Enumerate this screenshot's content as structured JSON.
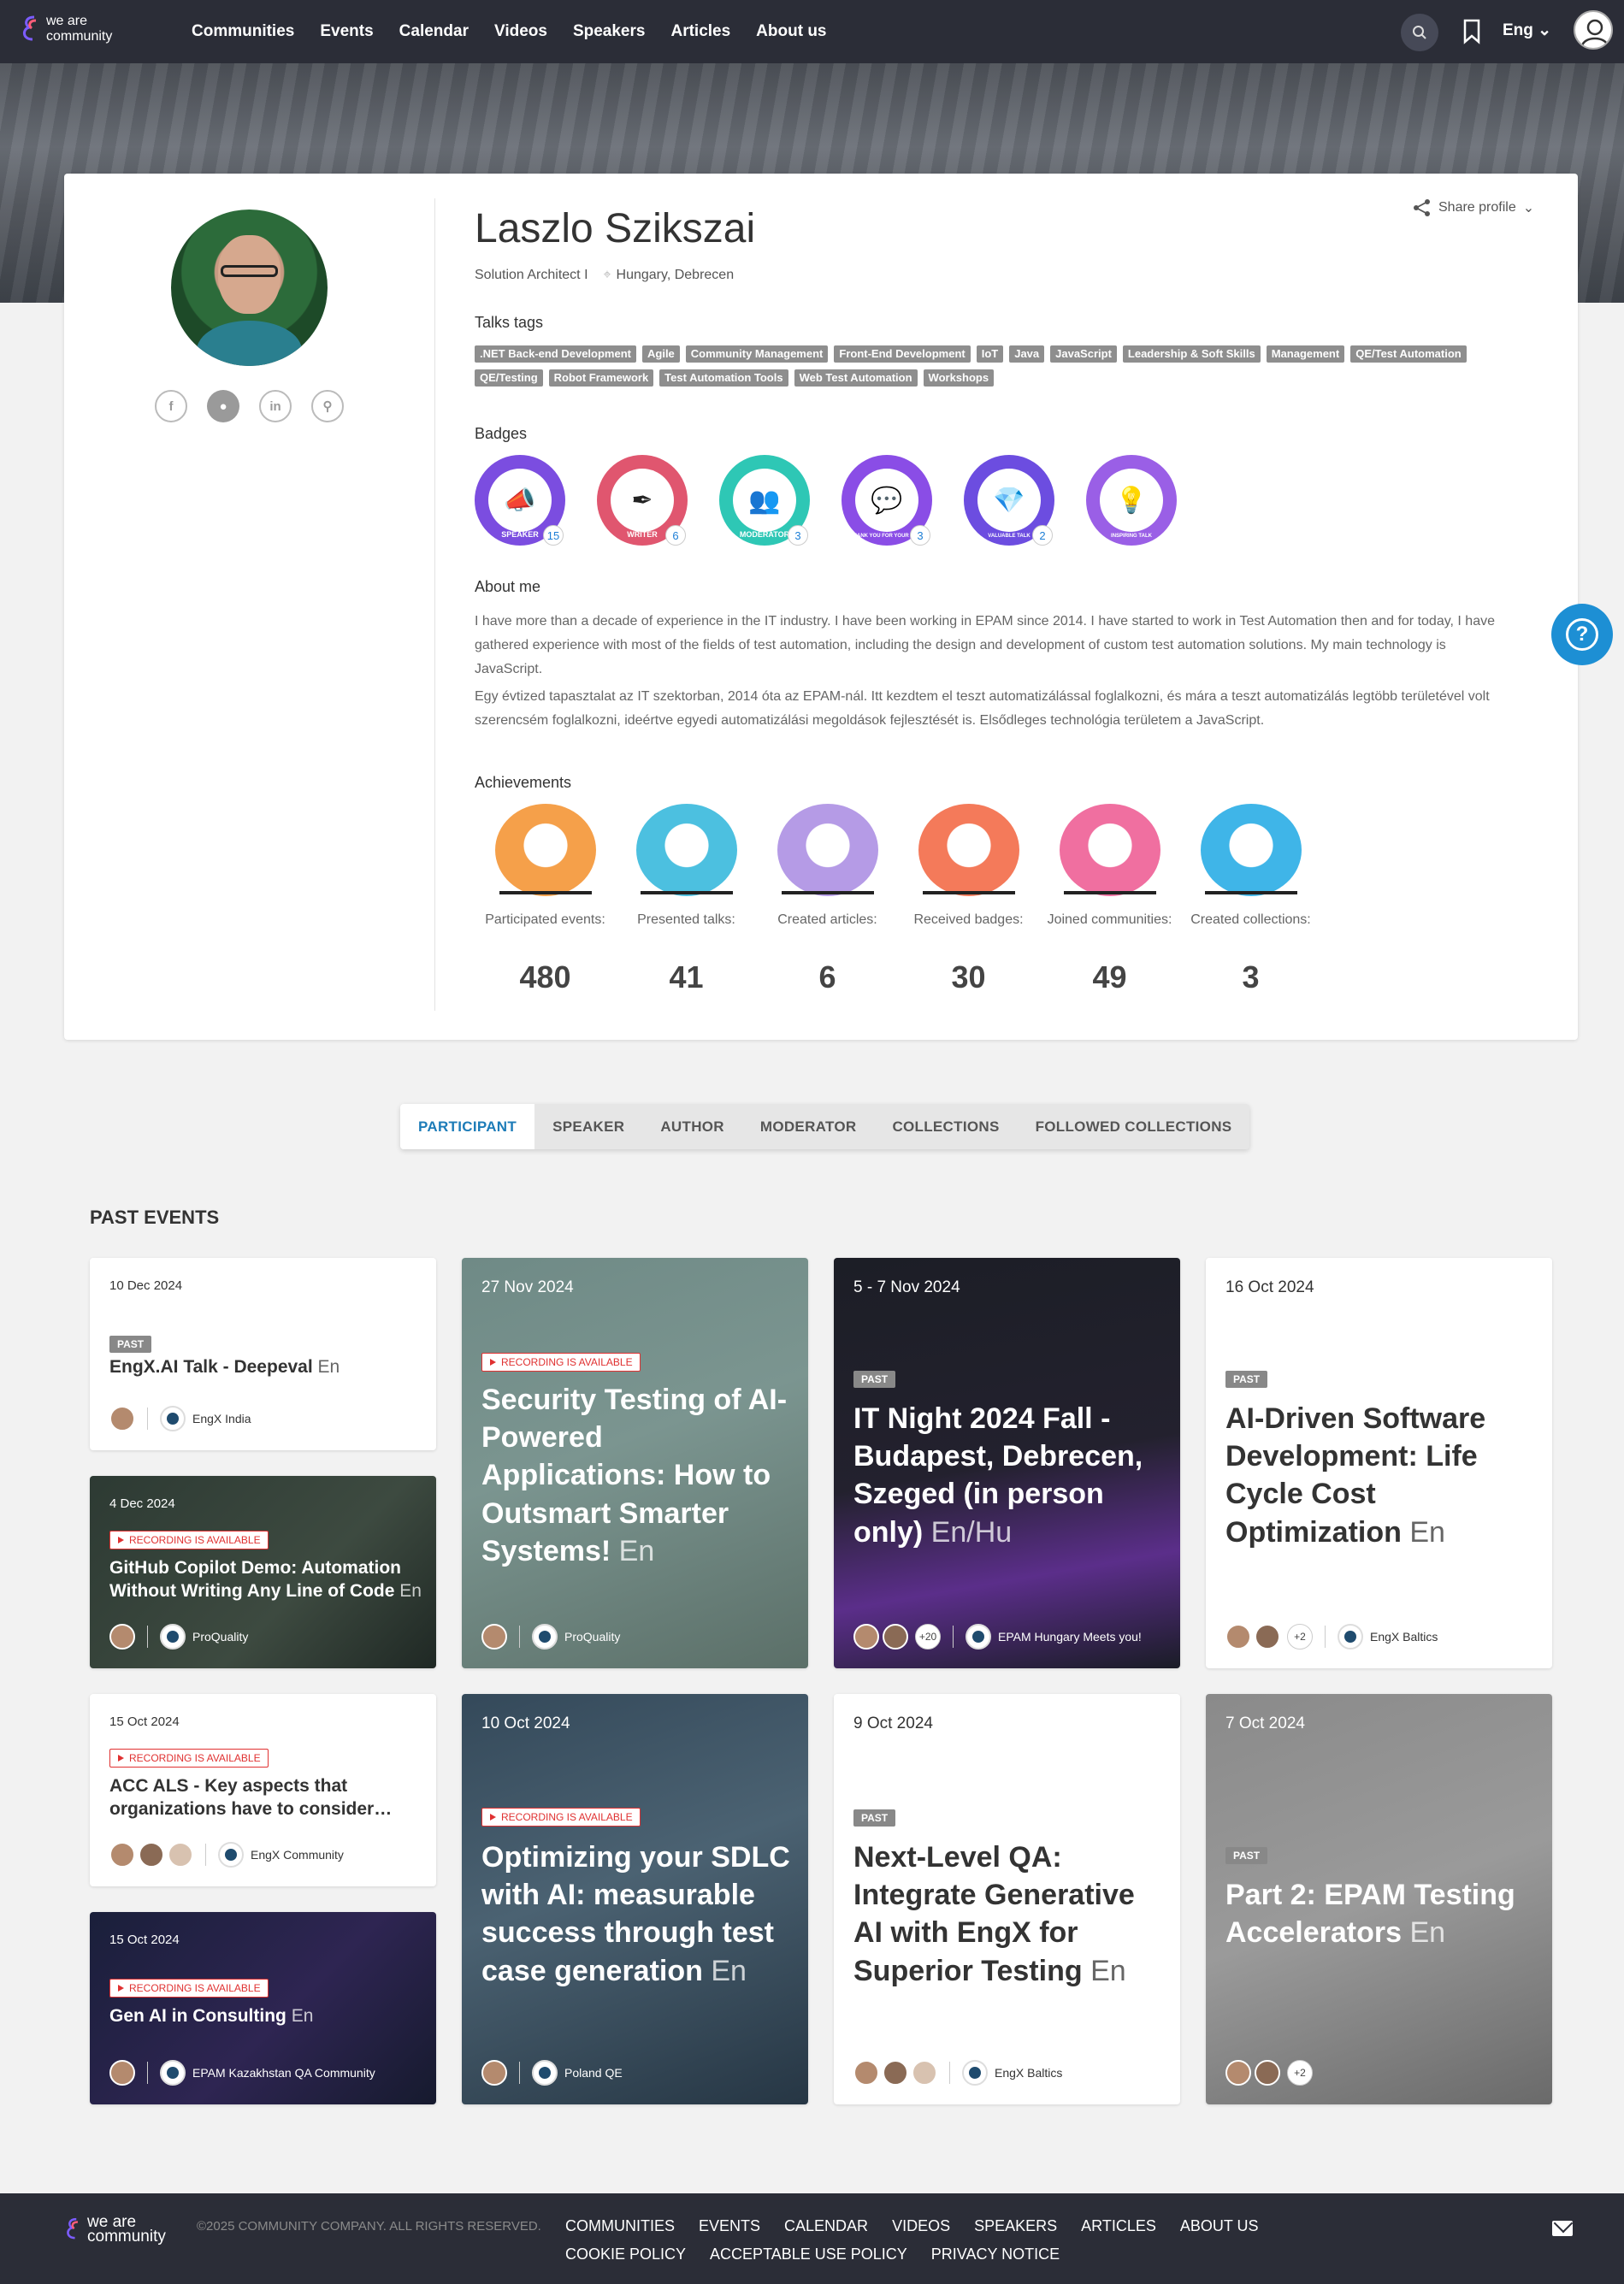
{
  "brand": {
    "line1": "we are",
    "line2": "community"
  },
  "nav": {
    "items": [
      "Communities",
      "Events",
      "Calendar",
      "Videos",
      "Speakers",
      "Articles",
      "About us"
    ],
    "language": "Eng"
  },
  "profile": {
    "name": "Laszlo Szikszai",
    "role": "Solution Architect I",
    "location": "Hungary, Debrecen",
    "share_label": "Share profile",
    "socials": [
      "facebook-icon",
      "github-icon",
      "linkedin-icon",
      "link-icon"
    ],
    "talks_tags_heading": "Talks tags",
    "tags": [
      ".NET Back-end Development",
      "Agile",
      "Community Management",
      "Front-End Development",
      "IoT",
      "Java",
      "JavaScript",
      "Leadership & Soft Skills",
      "Management",
      "QE/Test Automation",
      "QE/Testing",
      "Robot Framework",
      "Test Automation Tools",
      "Web Test Automation",
      "Workshops"
    ],
    "badges_heading": "Badges",
    "badges": [
      {
        "name": "SPEAKER",
        "count": "15",
        "color": "#7b4de0",
        "glyph": "📣"
      },
      {
        "name": "WRITER",
        "count": "6",
        "color": "#e0566f",
        "glyph": "✒"
      },
      {
        "name": "MODERATOR",
        "count": "3",
        "color": "#2ec7b5",
        "glyph": "👥"
      },
      {
        "name": "THANK YOU FOR YOUR TALK",
        "count": "3",
        "color": "#8a4de6",
        "glyph": "💬"
      },
      {
        "name": "VALUABLE TALK",
        "count": "2",
        "color": "#6c4de0",
        "glyph": "💎"
      },
      {
        "name": "INSPIRING TALK",
        "count": "",
        "color": "#9a5fe6",
        "glyph": "💡"
      }
    ],
    "about_heading": "About me",
    "about_p1": "I have more than a decade of experience in the IT industry. I have been working in EPAM since 2014. I have started to work in Test Automation then and for today, I have gathered experience with most of the fields of test automation, including the design and development of custom test automation solutions. My main technology is JavaScript.",
    "about_p2": "Egy évtized tapasztalat az IT szektorban, 2014 óta az EPAM-nál. Itt kezdtem el teszt automatizálással foglalkozni, és mára a teszt automatizálás legtöbb területével volt szerencsém foglalkozni, ideértve egyedi automatizálási megoldások fejlesztését is. Elsődleges technológia területem a JavaScript.",
    "achievements_heading": "Achievements",
    "achievements": [
      {
        "label": "Participated events:",
        "value": "480",
        "color": "#f5a04a"
      },
      {
        "label": "Presented talks:",
        "value": "41",
        "color": "#4cc0e0"
      },
      {
        "label": "Created articles:",
        "value": "6",
        "color": "#b59be6"
      },
      {
        "label": "Received badges:",
        "value": "30",
        "color": "#f47a5a"
      },
      {
        "label": "Joined communities:",
        "value": "49",
        "color": "#f06fa0"
      },
      {
        "label": "Created collections:",
        "value": "3",
        "color": "#3fb5e8"
      }
    ]
  },
  "tabs": [
    "PARTICIPANT",
    "SPEAKER",
    "AUTHOR",
    "MODERATOR",
    "COLLECTIONS",
    "FOLLOWED COLLECTIONS"
  ],
  "past_events_heading": "PAST EVENTS",
  "events": [
    {
      "date": "10 Dec 2024",
      "status": "PAST",
      "title": "EngX.AI Talk - Deepeval",
      "lang": "En",
      "community": "EngX India"
    },
    {
      "date": "4 Dec 2024",
      "status": "RECORDING IS AVAILABLE",
      "title": "GitHub Copilot Demo: Automation Without Writing Any Line of Code",
      "lang": "En",
      "community": "ProQuality"
    },
    {
      "date": "15 Oct 2024",
      "status": "RECORDING IS AVAILABLE",
      "title": "ACC ALS - Key aspects that organizations have to consider…",
      "lang": "",
      "community": "EngX Community"
    },
    {
      "date": "15 Oct 2024",
      "status": "RECORDING IS AVAILABLE",
      "title": "Gen AI in Consulting",
      "lang": "En",
      "community": "EPAM Kazakhstan QA Community"
    },
    {
      "date": "27 Nov 2024",
      "status": "RECORDING IS AVAILABLE",
      "title": "Security Testing of AI-Powered Applications: How to Outsmart Smarter Systems!",
      "lang": "En",
      "community": "ProQuality"
    },
    {
      "date": "10 Oct 2024",
      "status": "RECORDING IS AVAILABLE",
      "title": "Optimizing your SDLC with AI: measurable success through test case generation",
      "lang": "En",
      "community": "Poland QE"
    },
    {
      "date": "5 - 7 Nov 2024",
      "status": "PAST",
      "title": "IT Night 2024 Fall - Budapest, Debrecen, Szeged (in person only)",
      "lang": "En/Hu",
      "community": "EPAM Hungary Meets you!",
      "extra": "+20"
    },
    {
      "date": "9 Oct 2024",
      "status": "PAST",
      "title": "Next-Level QA: Integrate Generative AI with EngX for Superior Testing",
      "lang": "En",
      "community": "EngX Baltics"
    },
    {
      "date": "16 Oct 2024",
      "status": "PAST",
      "title": "AI-Driven Software Development: Life Cycle Cost Optimization",
      "lang": "En",
      "community": "EngX Baltics",
      "extra": "+2"
    },
    {
      "date": "7 Oct 2024",
      "status": "PAST",
      "title": "Part 2: EPAM Testing Accelerators",
      "lang": "En",
      "community": "",
      "extra": "+2"
    }
  ],
  "footer": {
    "copyright": "©2025 COMMUNITY COMPANY. ALL RIGHTS RESERVED.",
    "links": [
      "COMMUNITIES",
      "EVENTS",
      "CALENDAR",
      "VIDEOS",
      "SPEAKERS",
      "ARTICLES",
      "ABOUT US",
      "COOKIE POLICY",
      "ACCEPTABLE USE POLICY",
      "PRIVACY NOTICE"
    ]
  }
}
